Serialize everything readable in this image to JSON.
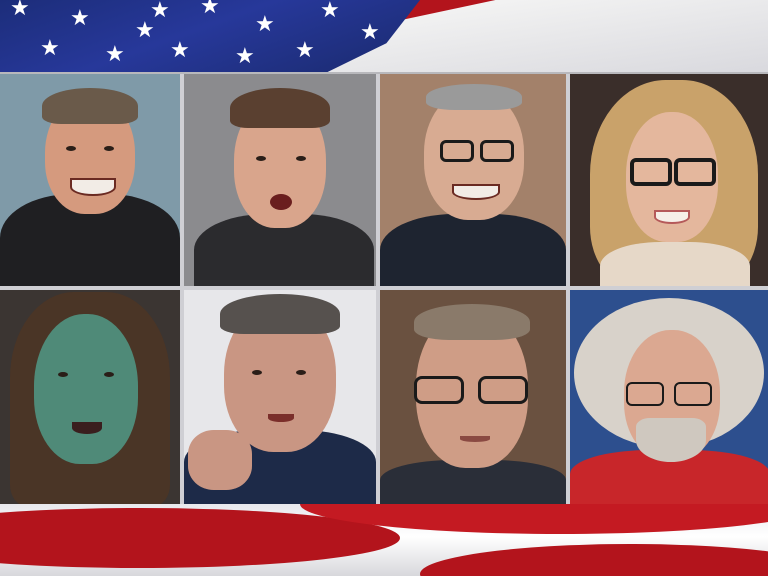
{
  "scene": {
    "flag_colors": {
      "blue": "#23358f",
      "red": "#b3141c",
      "white": "#ffffff"
    },
    "portraits": [
      {
        "id": 1,
        "background": "#7f9aa8",
        "skin": "#d59a7e",
        "hair": "#6a5a4a",
        "clothing": "#1f1f22"
      },
      {
        "id": 2,
        "background": "#8b8b8e",
        "skin": "#d9a58c",
        "hair": "#5a4030",
        "clothing": "#2b2b2e"
      },
      {
        "id": 3,
        "background": "#a3816a",
        "skin": "#d8ab92",
        "hair": "#9a9a9a",
        "clothing": "#1e2430"
      },
      {
        "id": 4,
        "background": "#3a2e2a",
        "skin": "#e4b79d",
        "hair": "#c9a26a",
        "clothing": "#e6d8c8"
      },
      {
        "id": 5,
        "background": "#3b3532",
        "skin": "#4f8a78",
        "hair": "#4a3526",
        "clothing": "#3a3230"
      },
      {
        "id": 6,
        "background": "#e7e7ea",
        "skin": "#c99683",
        "hair": "#56514e",
        "clothing": "#1d2a48"
      },
      {
        "id": 7,
        "background": "#6a5140",
        "skin": "#cf9d86",
        "hair": "#8a7a6a",
        "clothing": "#2a2e38"
      },
      {
        "id": 8,
        "background": "#2d4f8e",
        "skin": "#dba891",
        "hair": "#d8d2ca",
        "clothing": "#c8262a"
      }
    ]
  }
}
